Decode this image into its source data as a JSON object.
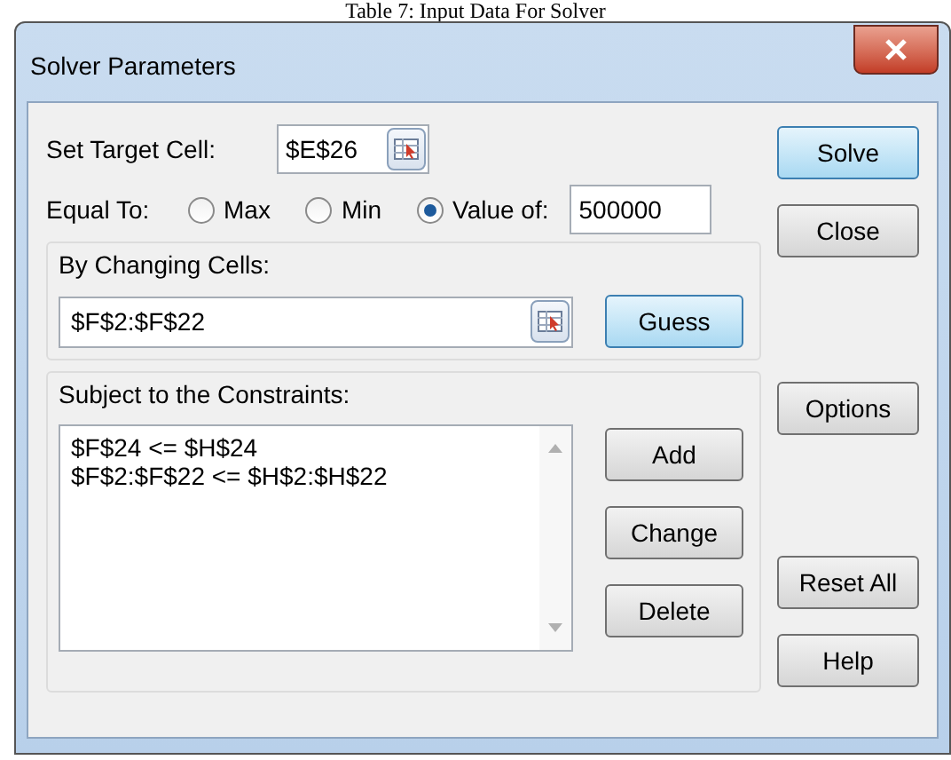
{
  "caption": "Table 7: Input Data For Solver",
  "window": {
    "title": "Solver Parameters"
  },
  "target_cell": {
    "label": "Set Target Cell:",
    "value": "$E$26"
  },
  "equal_to": {
    "label": "Equal To:",
    "options": [
      {
        "label": "Max",
        "selected": false
      },
      {
        "label": "Min",
        "selected": false
      },
      {
        "label": "Value of:",
        "selected": true
      }
    ],
    "value": "500000"
  },
  "changing_cells": {
    "label": "By Changing Cells:",
    "value": "$F$2:$F$22",
    "button": {
      "label": "Guess",
      "highlighted": true
    }
  },
  "constraints": {
    "label": "Subject to the Constraints:",
    "items": [
      "$F$24 <= $H$24",
      "$F$2:$F$22 <= $H$2:$H$22"
    ],
    "buttons": [
      {
        "label": "Add",
        "highlighted": false
      },
      {
        "label": "Change",
        "highlighted": false
      },
      {
        "label": "Delete",
        "highlighted": false
      }
    ]
  },
  "side_buttons": [
    {
      "label": "Solve",
      "highlighted": true,
      "kind": "top"
    },
    {
      "label": "Close",
      "highlighted": false,
      "kind": "top"
    },
    {
      "label": "Options",
      "highlighted": false,
      "kind": "middle"
    },
    {
      "label": "Reset All",
      "highlighted": false,
      "kind": "bottom"
    },
    {
      "label": "Help",
      "highlighted": false,
      "kind": "bottom"
    }
  ]
}
